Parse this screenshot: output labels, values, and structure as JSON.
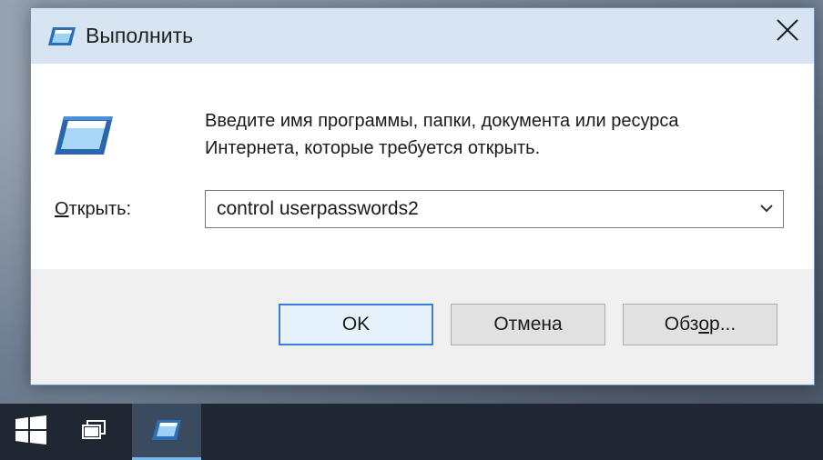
{
  "dialog": {
    "title": "Выполнить",
    "prompt_line1": "Введите имя программы, папки, документа или ресурса",
    "prompt_line2": "Интернета, которые требуется открыть.",
    "open_label_underlined": "О",
    "open_label_rest": "ткрыть:",
    "open_value": "control userpasswords2",
    "ok_label": "OK",
    "cancel_label": "Отмена",
    "browse_label_before": "Обз",
    "browse_label_underlined": "о",
    "browse_label_after": "р..."
  },
  "icons": {
    "title": "run-dialog-icon",
    "main": "run-dialog-icon",
    "close": "close-icon",
    "dropdown": "chevron-down-icon",
    "start": "windows-start-icon",
    "task_view": "task-view-icon",
    "taskbar_run": "run-dialog-icon"
  },
  "colors": {
    "titlebar": "#d7e4f2",
    "footer": "#f0f0f0",
    "ok_border": "#3b7ddb",
    "taskbar": "#1f2733",
    "taskbar_active": "#3a4a5f"
  }
}
